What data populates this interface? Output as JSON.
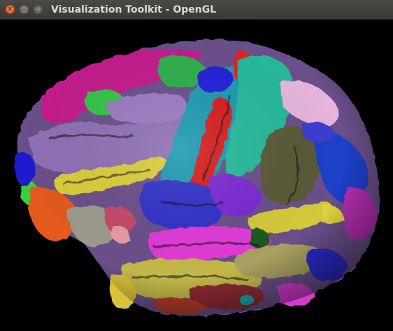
{
  "window": {
    "title": "Visualization Toolkit - OpenGL",
    "buttons": {
      "close_glyph": "✕",
      "minimize_glyph": "–",
      "maximize_glyph": "□"
    }
  },
  "viewport": {
    "background": "#000000",
    "content": "brain-surface-render",
    "region_colors": [
      "#c21f8c",
      "#8a6ab2",
      "#1a9aa8",
      "#2bbf9a",
      "#d61e1e",
      "#2424d8",
      "#d4c83a",
      "#e03ad6",
      "#e8a4d8",
      "#5a5a38",
      "#3c8c3c",
      "#e85a14",
      "#8c8c8c",
      "#7a2a4a"
    ]
  }
}
